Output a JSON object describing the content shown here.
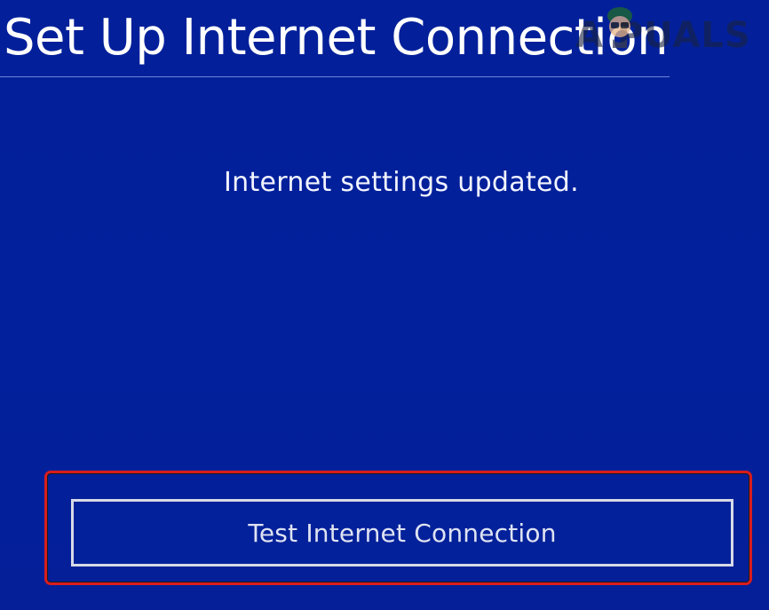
{
  "header": {
    "title": "Set Up Internet Connection"
  },
  "watermark": {
    "text": "A  PUALS",
    "icon": "mascot-icon"
  },
  "main": {
    "status_message": "Internet settings updated."
  },
  "actions": {
    "test_button_label": "Test Internet Connection"
  },
  "colors": {
    "background": "#02209b",
    "text": "#ffffff",
    "highlight": "#d81d1d",
    "button_border": "#d7dae6"
  }
}
